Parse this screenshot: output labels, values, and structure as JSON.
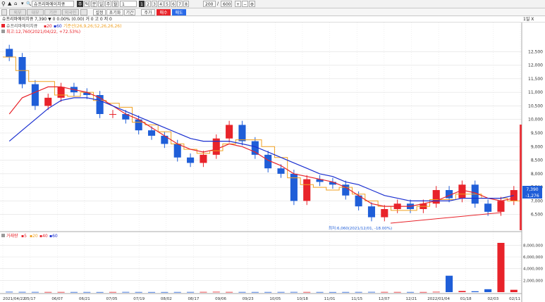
{
  "toolbar": {
    "icons": [
      "search-icon",
      "arrow-up-icon",
      "home-icon",
      "dropdown-icon"
    ],
    "stock_name": "슈프리마에이치큐",
    "period_tabs": [
      "주",
      "틱",
      "분",
      "일",
      "주",
      "월",
      "년"
    ],
    "number_tabs": [
      "1",
      "2",
      "3",
      "4",
      "5",
      "6",
      "7",
      "8"
    ],
    "checkboxes": [
      "체결",
      "호가",
      "관심",
      "예측",
      "미결"
    ],
    "setting_label": "설정",
    "init_label": "초기화",
    "jump_label": "기간",
    "cycle_value": "1",
    "count_display": "200",
    "total_display": "600"
  },
  "toolbar2": {
    "left_tabs": [
      "외부",
      "대부",
      "기관",
      "외국인"
    ],
    "mode_buttons": [
      "주가",
      "매수",
      "매도"
    ],
    "one_day_label": "1일"
  },
  "header": {
    "price_line": "슈프리마에이치큐  7,390  ▼  0  0.00%  (0.00)  거  0  고  0  저  0",
    "close_label": "1일 X"
  },
  "legend": {
    "price_item": "슈프리마에이치큐",
    "ma20": "20",
    "ma60": "60",
    "ichimoku": "기준선(26,9,26;52,26,26,26)",
    "high_note": "최고:12,760(2021/04/22, +72.53%)",
    "low_note": "최저:6,060(2021/12/01, -18.00%)"
  },
  "volume": {
    "legend_title": "거래량",
    "legend_items": [
      "5",
      "20",
      "40",
      "60"
    ],
    "y_ticks": [
      "8,000,000",
      "6,000,000",
      "4,000,000",
      "2,000,000"
    ]
  },
  "price_axis": {
    "ticks": [
      "12,500",
      "12,000",
      "11,500",
      "11,000",
      "10,500",
      "10,000",
      "9,500",
      "9,000",
      "8,500",
      "8,000",
      "7,500",
      "7,000",
      "6,500"
    ],
    "current_price": "7,390",
    "current_change": "-1,276"
  },
  "x_axis": {
    "labels": [
      "2021/04/22",
      "05/17",
      "06/07",
      "06/21",
      "07/05",
      "07/19",
      "08/02",
      "08/17",
      "09/06",
      "09/23",
      "10/05",
      "10/18",
      "11/01",
      "11/15",
      "12/07",
      "12/21",
      "2022/01/04",
      "01/18",
      "02/03",
      "02/11"
    ]
  },
  "colors": {
    "up": "#e8232a",
    "down": "#1f5ed8",
    "ma20": "#e8232a",
    "ma60": "#1a2fd0",
    "ichimoku": "#f0a020",
    "grid": "#e0e0e0"
  },
  "chart_data": {
    "type": "candlestick",
    "title": "슈프리마에이치큐",
    "ylim": [
      6000,
      13000
    ],
    "y_unit": "KRW",
    "x_range": [
      "2021/04/22",
      "2022/02/11"
    ],
    "current_price": 7390,
    "highest": {
      "value": 12760,
      "date": "2021/04/22",
      "pct": "+72.53%"
    },
    "lowest": {
      "value": 6060,
      "date": "2021/12/01",
      "pct": "-18.00%"
    },
    "close_series": [
      12300,
      11300,
      10500,
      10800,
      11200,
      11000,
      10900,
      10200,
      10200,
      10000,
      9600,
      9400,
      9100,
      8600,
      8400,
      8700,
      9300,
      9800,
      9200,
      8700,
      8200,
      8000,
      7000,
      7800,
      7700,
      7600,
      7200,
      6800,
      6400,
      6700,
      6900,
      6700,
      6900,
      7400,
      7100,
      7600,
      6900,
      6600,
      7000,
      7400
    ],
    "ma20_series": [
      10200,
      10800,
      11000,
      11200,
      11200,
      11100,
      11000,
      10800,
      10500,
      10200,
      10000,
      9700,
      9400,
      9100,
      8900,
      8800,
      8900,
      9100,
      9000,
      8800,
      8500,
      8300,
      8000,
      7900,
      7800,
      7700,
      7500,
      7200,
      6900,
      6800,
      6800,
      6800,
      6900,
      7000,
      7200,
      7400,
      7300,
      7100,
      7000,
      7100
    ],
    "ma60_series": [
      9200,
      9600,
      10000,
      10400,
      10700,
      10800,
      10800,
      10700,
      10500,
      10300,
      10100,
      9900,
      9700,
      9500,
      9300,
      9200,
      9200,
      9200,
      9100,
      9000,
      8800,
      8600,
      8400,
      8200,
      8000,
      7900,
      7700,
      7600,
      7400,
      7200,
      7100,
      7000,
      7000,
      7000,
      7000,
      7100,
      7100,
      7100,
      7100,
      7200
    ],
    "volume_series": [
      60000,
      40000,
      35000,
      30000,
      30000,
      25000,
      25000,
      20000,
      30000,
      35000,
      25000,
      20000,
      20000,
      25000,
      30000,
      40000,
      60000,
      35000,
      30000,
      25000,
      25000,
      30000,
      35000,
      30000,
      25000,
      20000,
      25000,
      30000,
      40000,
      35000,
      30000,
      25000,
      25000,
      60000,
      2800000,
      200000,
      150000,
      500000,
      8400000,
      400000
    ]
  }
}
